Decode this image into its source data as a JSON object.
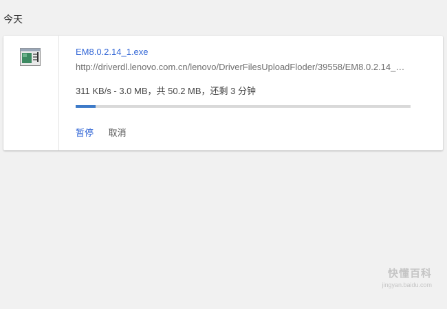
{
  "section": {
    "date_label": "今天"
  },
  "download": {
    "icon": "exe-file-icon",
    "file_name": "EM8.0.2.14_1.exe",
    "url": "http://driverdl.lenovo.com.cn/lenovo/DriverFilesUploadFloder/39558/EM8.0.2.14_…",
    "status": "311 KB/s - 3.0 MB，共 50.2 MB，还剩 3 分钟",
    "progress_percent": 6,
    "pause_label": "暂停",
    "cancel_label": "取消"
  },
  "watermark": {
    "logo_text": "快懂百科",
    "site": "jingyan.baidu.com"
  },
  "colors": {
    "background": "#f1f1f1",
    "link": "#3367d6",
    "progress": "#3d7ac8",
    "track": "#d9d9d9"
  }
}
